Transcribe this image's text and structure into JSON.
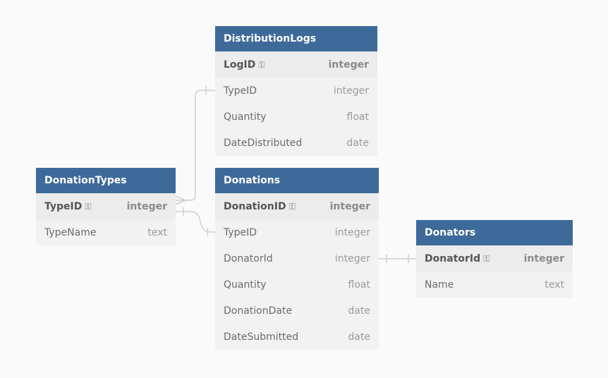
{
  "tables": [
    {
      "name": "DistributionLogs",
      "columns": [
        {
          "name": "LogID",
          "type": "integer",
          "pk": true
        },
        {
          "name": "TypeID",
          "type": "integer"
        },
        {
          "name": "Quantity",
          "type": "float"
        },
        {
          "name": "DateDistributed",
          "type": "date"
        }
      ]
    },
    {
      "name": "DonationTypes",
      "columns": [
        {
          "name": "TypeID",
          "type": "integer",
          "pk": true
        },
        {
          "name": "TypeName",
          "type": "text"
        }
      ]
    },
    {
      "name": "Donations",
      "columns": [
        {
          "name": "DonationID",
          "type": "integer",
          "pk": true
        },
        {
          "name": "TypeID",
          "type": "integer"
        },
        {
          "name": "DonatorId",
          "type": "integer"
        },
        {
          "name": "Quantity",
          "type": "float"
        },
        {
          "name": "DonationDate",
          "type": "date"
        },
        {
          "name": "DateSubmitted",
          "type": "date"
        }
      ]
    },
    {
      "name": "Donators",
      "columns": [
        {
          "name": "DonatorId",
          "type": "integer",
          "pk": true
        },
        {
          "name": "Name",
          "type": "text"
        }
      ]
    }
  ],
  "relationships": [
    {
      "from": "DonationTypes.TypeID",
      "to": "DistributionLogs.TypeID",
      "from_end": "many",
      "to_end": "one"
    },
    {
      "from": "DonationTypes.TypeID",
      "to": "Donations.TypeID",
      "from_end": "one",
      "to_end": "one"
    },
    {
      "from": "Donations.DonatorId",
      "to": "Donators.DonatorId",
      "from_end": "one",
      "to_end": "one"
    }
  ],
  "colors": {
    "header": "#3d6a99",
    "row": "#f2f2f2",
    "background": "#fafafa",
    "connector": "#cccccc"
  },
  "icons": {
    "primary_key": "key-icon"
  }
}
